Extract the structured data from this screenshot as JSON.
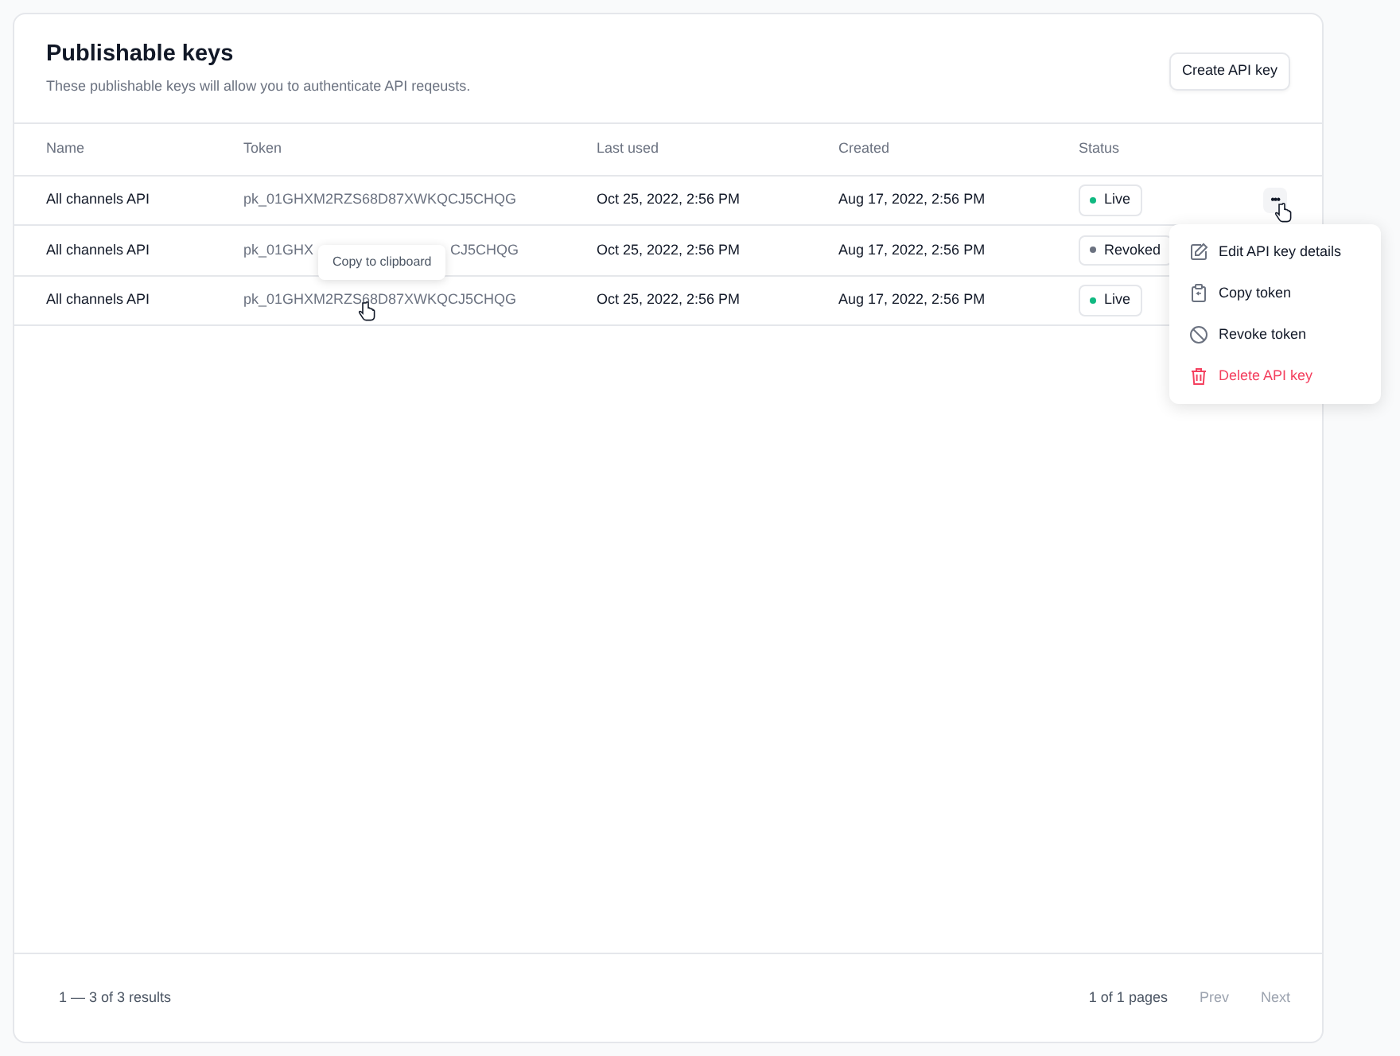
{
  "header": {
    "title": "Publishable keys",
    "subtitle": "These publishable keys will allow you to authenticate API reqeusts.",
    "create_button": "Create API key"
  },
  "table": {
    "columns": [
      "Name",
      "Token",
      "Last used",
      "Created",
      "Status"
    ],
    "rows": [
      {
        "name": "All channels API",
        "token_parts": [
          "pk_01GHXM2RZS68D87XWKQCJ5CHQG"
        ],
        "last_used": "Oct 25, 2022, 2:56 PM",
        "created": "Aug 17, 2022, 2:56 PM",
        "status": {
          "label": "Live",
          "color": "#10b981"
        },
        "actions": "•••"
      },
      {
        "name": "All channels API",
        "token_parts": [
          "pk_01GHX",
          "CJ5CHQG"
        ],
        "last_used": "Oct 25, 2022, 2:56 PM",
        "created": "Aug 17, 2022, 2:56 PM",
        "status": {
          "label": "Revoked",
          "color": "#6b7280"
        }
      },
      {
        "name": "All channels API",
        "token_parts": [
          "pk_01GHXM2RZS68D87XWKQCJ5CHQG"
        ],
        "last_used": "Oct 25, 2022, 2:56 PM",
        "created": "Aug 17, 2022, 2:56 PM",
        "status": {
          "label": "Live",
          "color": "#10b981"
        }
      }
    ]
  },
  "tooltip": "Copy to clipboard",
  "menu": [
    {
      "label": "Edit API key details",
      "kind": "normal"
    },
    {
      "label": "Copy token",
      "kind": "normal"
    },
    {
      "label": "Revoke token",
      "kind": "normal"
    },
    {
      "label": "Delete API key",
      "kind": "danger"
    }
  ],
  "footer": {
    "range": "1 — 3 of 3 results",
    "pages": "1 of 1 pages",
    "prev": {
      "label": "Prev",
      "disabled": true
    },
    "next": {
      "label": "Next",
      "disabled": true
    }
  }
}
